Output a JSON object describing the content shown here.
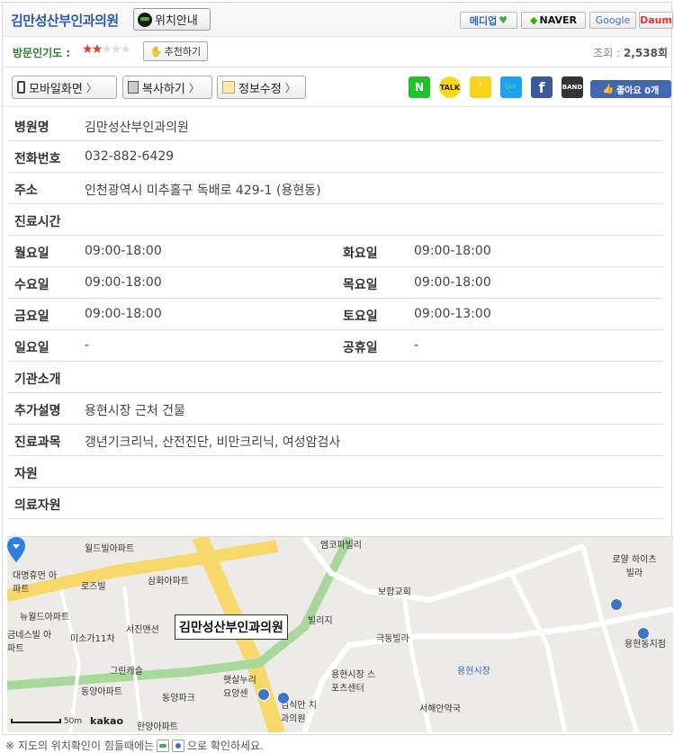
{
  "header": {
    "title": "김만성산부인과의원",
    "location_button": "위치안내",
    "portals": [
      "메디업",
      "NAVER",
      "Google",
      "Daum"
    ]
  },
  "popularity": {
    "label": "방문인기도 :",
    "rating": 2,
    "max_rating": 5,
    "recommend_button": "추천하기",
    "views_label": "조회 :",
    "views_value": "2,538회"
  },
  "actions": {
    "mobile": "모바일화면",
    "copy": "복사하기",
    "edit": "정보수정",
    "sns": [
      "N",
      "TALK",
      "kakaostory",
      "twitter",
      "facebook",
      "BAND"
    ],
    "like": "좋아요 0개"
  },
  "info": {
    "name_label": "병원명",
    "name": "김만성산부인과의원",
    "phone_label": "전화번호",
    "phone": "032-882-6429",
    "address_label": "주소",
    "address": "인천광역시 미추홀구 독배로 429-1 (용현동)",
    "hours_label": "진료시간",
    "hours": [
      {
        "day": "월요일",
        "time": "09:00-18:00",
        "day2": "화요일",
        "time2": "09:00-18:00"
      },
      {
        "day": "수요일",
        "time": "09:00-18:00",
        "day2": "목요일",
        "time2": "09:00-18:00"
      },
      {
        "day": "금요일",
        "time": "09:00-18:00",
        "day2": "토요일",
        "time2": "09:00-13:00"
      },
      {
        "day": "일요일",
        "time": "-",
        "day2": "공휴일",
        "time2": "-"
      }
    ],
    "intro_label": "기관소개",
    "extra_label": "추가설명",
    "extra": "용현시장 근처 건물",
    "dept_label": "진료과목",
    "dept": "갱년기크리닉, 산전진단, 비만크리닉, 여성암검사",
    "staff_label": "자원",
    "medical_staff_label": "의료자원"
  },
  "map": {
    "callout": "김만성산부인과의원",
    "scale": "50m",
    "brand": "kakao",
    "labels": [
      "월드빌아파트",
      "대명휴먼 아파트",
      "로즈빌",
      "삼화아파트",
      "뉴월드아파트",
      "서진맨션",
      "미소가11차",
      "그린캐슬",
      "동양아파트",
      "동양파크",
      "한양아파트",
      "햇살누리 요양센",
      "김식만 치과의원",
      "용현시장 스포츠센터",
      "용현시장",
      "서해안약국",
      "극동빌라",
      "보합교회",
      "로얄 하이츠빌라",
      "용현동지점",
      "빌리지",
      "엠코파빌리",
      "금네스빌 아파트"
    ]
  },
  "footer": {
    "pre": "※ 지도의 위치확인이 힘들때에는",
    "post": "으로 확인하세요."
  }
}
